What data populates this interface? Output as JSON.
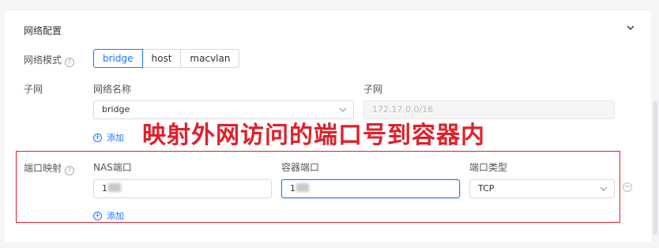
{
  "section": {
    "title": "网络配置"
  },
  "network_mode": {
    "label": "网络模式",
    "options": [
      "bridge",
      "host",
      "macvlan"
    ],
    "selected": "bridge"
  },
  "subnet_row": {
    "label": "子网",
    "name_header": "网络名称",
    "subnet_header": "子网",
    "network_name_value": "bridge",
    "subnet_value": "172.17.0.0/16",
    "add_label": "添加"
  },
  "port_mapping": {
    "label": "端口映射",
    "nas_port_header": "NAS端口",
    "container_port_header": "容器端口",
    "port_type_header": "端口类型",
    "nas_port_value": "1",
    "container_port_value": "1",
    "port_type_value": "TCP",
    "add_label": "添加"
  },
  "annotation": {
    "text": "映射外网访问的端口号到容器内",
    "color": "#e0202a"
  },
  "colors": {
    "accent": "#1677ff",
    "highlight": "#e0202a"
  },
  "icons": {
    "collapse": "chevron-down-icon",
    "help": "help-circle-icon",
    "add": "plus-circle-icon",
    "remove": "minus-circle-icon",
    "dropdown": "chevron-down-icon"
  }
}
